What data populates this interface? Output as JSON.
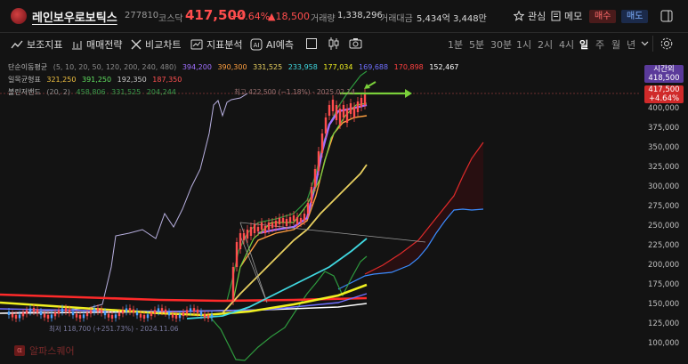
{
  "header": {
    "stock_name": "레인보우로보틱스",
    "stock_code": "277810",
    "market": "코스닥",
    "price": "417,500",
    "change_pct": "+4.64%",
    "change_abs": "▲18,500",
    "volume_label": "거래량",
    "volume_value": "1,338,296",
    "amount_label": "거래대금",
    "amount_value": "5,434억 3,448만",
    "watch_label": "관심",
    "memo_label": "메모",
    "buy_label": "매수",
    "sell_label": "매도"
  },
  "toolbar": {
    "indicators_label": "보조지표",
    "strategy_label": "매매전략",
    "compare_label": "비교차트",
    "analysis_label": "지표분석",
    "ai_label": "AI예측",
    "timeframes": [
      "1분",
      "5분",
      "30분",
      "1시",
      "2시",
      "4시",
      "일",
      "주",
      "월",
      "년"
    ],
    "active_timeframe": "일"
  },
  "indicators": {
    "sma": {
      "label": "단순이동평균",
      "params": "(5, 10, 20, 50, 120, 200, 240, 480)",
      "values": [
        {
          "v": "394,200",
          "color": "#a070ff"
        },
        {
          "v": "390,300",
          "color": "#ffa040"
        },
        {
          "v": "331,525",
          "color": "#e8d060"
        },
        {
          "v": "233,958",
          "color": "#40d8e0"
        },
        {
          "v": "177,034",
          "color": "#f0f020"
        },
        {
          "v": "169,688",
          "color": "#7070ff"
        },
        {
          "v": "170,898",
          "color": "#ff4040"
        },
        {
          "v": "152,467",
          "color": "#ffffff"
        }
      ]
    },
    "ichimoku": {
      "label": "일목균형표",
      "values": [
        {
          "v": "321,250",
          "color": "#f0c040"
        },
        {
          "v": "391,250",
          "color": "#60e060"
        },
        {
          "v": "192,350",
          "color": "#c8c8c8"
        },
        {
          "v": "187,350",
          "color": "#ff5050"
        }
      ]
    },
    "bollinger": {
      "label": "볼린저밴드",
      "params": "(20, 2)",
      "values": [
        {
          "v": "458,806",
          "color": "#3a9a4a"
        },
        {
          "v": "331,525",
          "color": "#3a9a4a"
        },
        {
          "v": "204,244",
          "color": "#3a9a4a"
        }
      ]
    }
  },
  "annotations": {
    "high": "최고 422,500 (−1.18%) - 2025.02.14",
    "low": "최저 118,700 (+251.73%) - 2024.11.06"
  },
  "yaxis": {
    "ticks": [
      "400,000",
      "375,000",
      "350,000",
      "325,000",
      "300,000",
      "275,000",
      "250,000",
      "225,000",
      "200,000",
      "175,000",
      "150,000",
      "125,000",
      "100,000"
    ],
    "remaining_label": "시간외",
    "remaining_value": "418,500",
    "current_price": "417,500",
    "current_pct": "+4.64%"
  },
  "watermark": "알파스퀘어",
  "colors": {
    "up": "#ff4d4d",
    "down": "#4da3ff",
    "bg": "#131313"
  }
}
